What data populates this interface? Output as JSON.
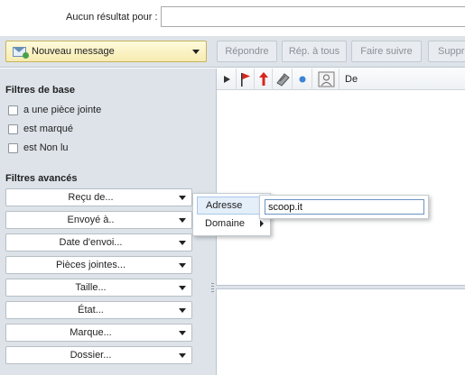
{
  "search": {
    "label": "Aucun résultat pour :",
    "value": ""
  },
  "toolbar": {
    "new_message": "Nouveau message",
    "buttons": [
      "Répondre",
      "Rép. à tous",
      "Faire suivre",
      "Suppr"
    ]
  },
  "filters": {
    "basic_title": "Filtres de base",
    "basic": [
      "a une pièce jointe",
      "est marqué",
      "est Non lu"
    ],
    "advanced_title": "Filtres avancés",
    "advanced": [
      "Reçu de...",
      "Envoyé à..",
      "Date d'envoi...",
      "Pièces jointes...",
      "Taille...",
      "État...",
      "Marque...",
      "Dossier..."
    ]
  },
  "message_list": {
    "columns": {
      "from": "De"
    },
    "icons": [
      "thread-expand-icon",
      "flag-icon",
      "priority-icon",
      "attachment-icon",
      "read-status-icon",
      "sender-contact-icon"
    ]
  },
  "context_menu": {
    "items": [
      "Adresse",
      "Domaine"
    ],
    "address_value": "scoop.it"
  },
  "colors": {
    "panel_bg": "#dde3e9",
    "new_message_bg": "#f6ebb0",
    "highlight": "#e4effa",
    "flag_red": "#d9261c"
  }
}
